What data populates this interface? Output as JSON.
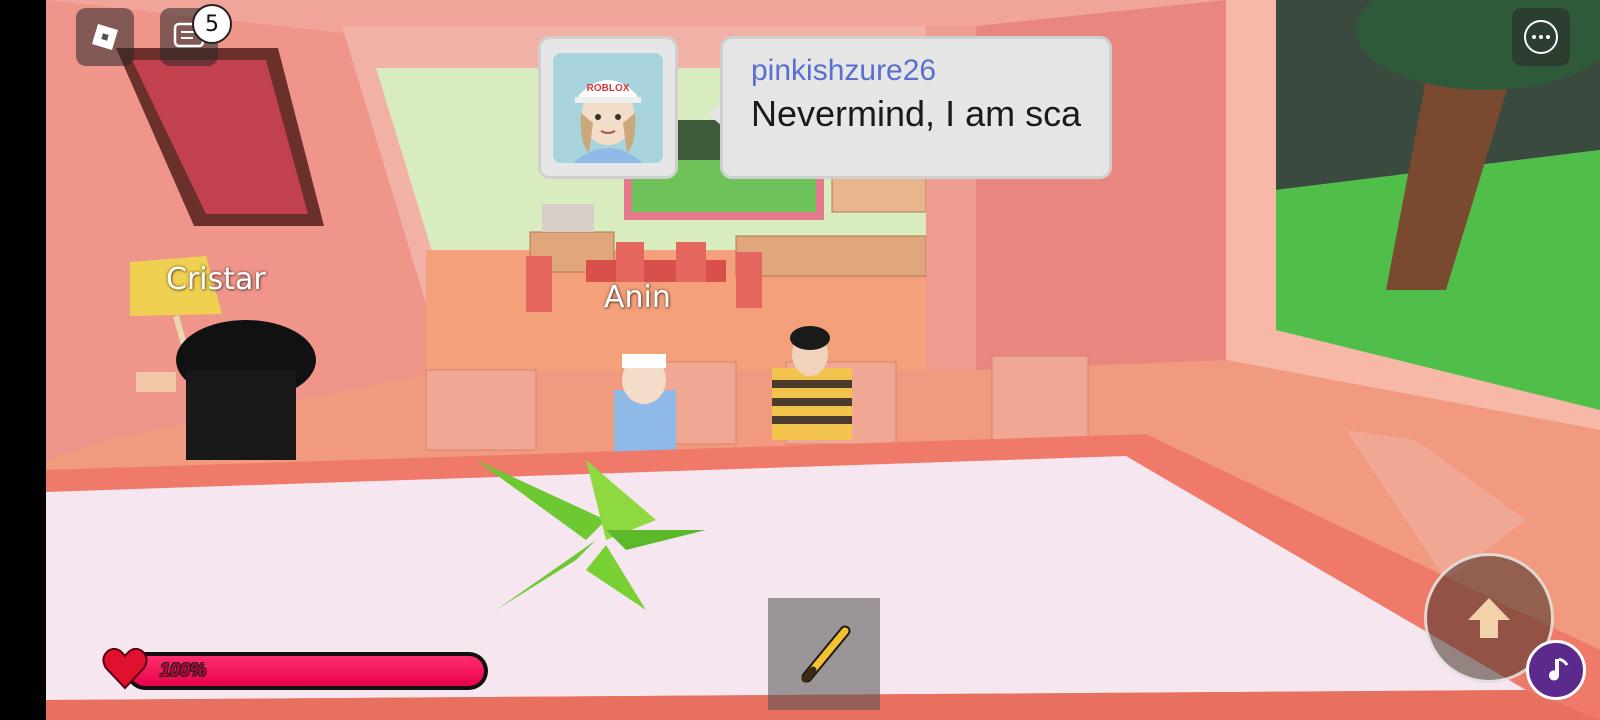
{
  "hud": {
    "chat_unread_count": "5",
    "health_percent_label": "100%",
    "health_fraction": 1.0
  },
  "chat": {
    "username": "pinkishzure26",
    "message": "Nevermind, I am sca",
    "avatar_cap_text": "ROBLOX"
  },
  "players": {
    "nametag_1": "Cristar",
    "nametag_2": "Anin"
  },
  "hotbar": {
    "slot_1_item": "baseball-bat-icon"
  },
  "colors": {
    "health_fill": "#ff1f5e",
    "chat_username": "#5a6fd0",
    "wall_pink": "#e8867f",
    "music_button": "#5b2a8c"
  }
}
